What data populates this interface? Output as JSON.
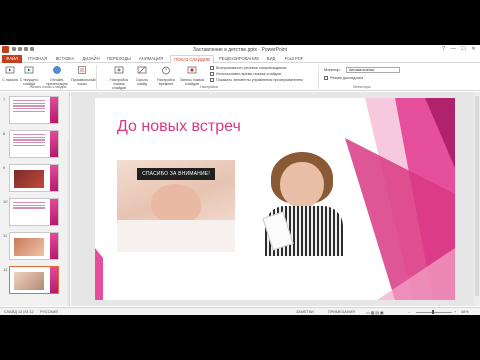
{
  "window": {
    "title": "Заставление в детстве.pptx - PowerPoint",
    "controls": [
      "?",
      "—",
      "☐",
      "✕"
    ]
  },
  "tabs": [
    {
      "label": "ФАЙЛ",
      "kind": "file"
    },
    {
      "label": "ГЛАВНАЯ"
    },
    {
      "label": "ВСТАВКА"
    },
    {
      "label": "ДИЗАЙН"
    },
    {
      "label": "ПЕРЕХОДЫ"
    },
    {
      "label": "АНИМАЦИЯ"
    },
    {
      "label": "ПОКАЗ СЛАЙДОВ",
      "kind": "active"
    },
    {
      "label": "РЕЦЕНЗИРОВАНИЕ"
    },
    {
      "label": "ВИД"
    },
    {
      "label": "Foxit PDF"
    }
  ],
  "ribbon": {
    "buttons": [
      {
        "label": "С начала"
      },
      {
        "label": "С текущего слайда"
      },
      {
        "label": "Онлайн-презентация"
      },
      {
        "label": "Произвольный показ"
      },
      {
        "label": "Настройка показа слайдов"
      },
      {
        "label": "Скрыть слайд"
      },
      {
        "label": "Настройка времени"
      },
      {
        "label": "Запись показа слайдов"
      }
    ],
    "group_start": "Начать показ слайдов",
    "group_setup": "Настройка",
    "group_monitors": "Мониторы",
    "checkboxes": [
      "Воспроизвести речевое сопровождение",
      "Использовать время показа слайдов",
      "Показать элементы управления проигрывателем"
    ],
    "monitor_label": "Монитор:",
    "monitor_value": "Автоматически",
    "presenter_mode": "Режим докладчика"
  },
  "thumbnails": [
    {
      "num": "7"
    },
    {
      "num": "8"
    },
    {
      "num": "9"
    },
    {
      "num": "10"
    },
    {
      "num": "11"
    },
    {
      "num": "12"
    }
  ],
  "slide": {
    "title": "До новых встреч",
    "caption": "СПАСИБО ЗА ВНИМАНИЕ!"
  },
  "statusbar": {
    "slide_info": "СЛАЙД 12 ИЗ 12",
    "language": "РУССКИЙ",
    "notes": "ЗАМЕТКИ",
    "comments": "ПРИМЕЧАНИЯ",
    "zoom": "48%"
  },
  "colors": {
    "accent": "#c43e1c",
    "slide_pink": "#d93884"
  }
}
